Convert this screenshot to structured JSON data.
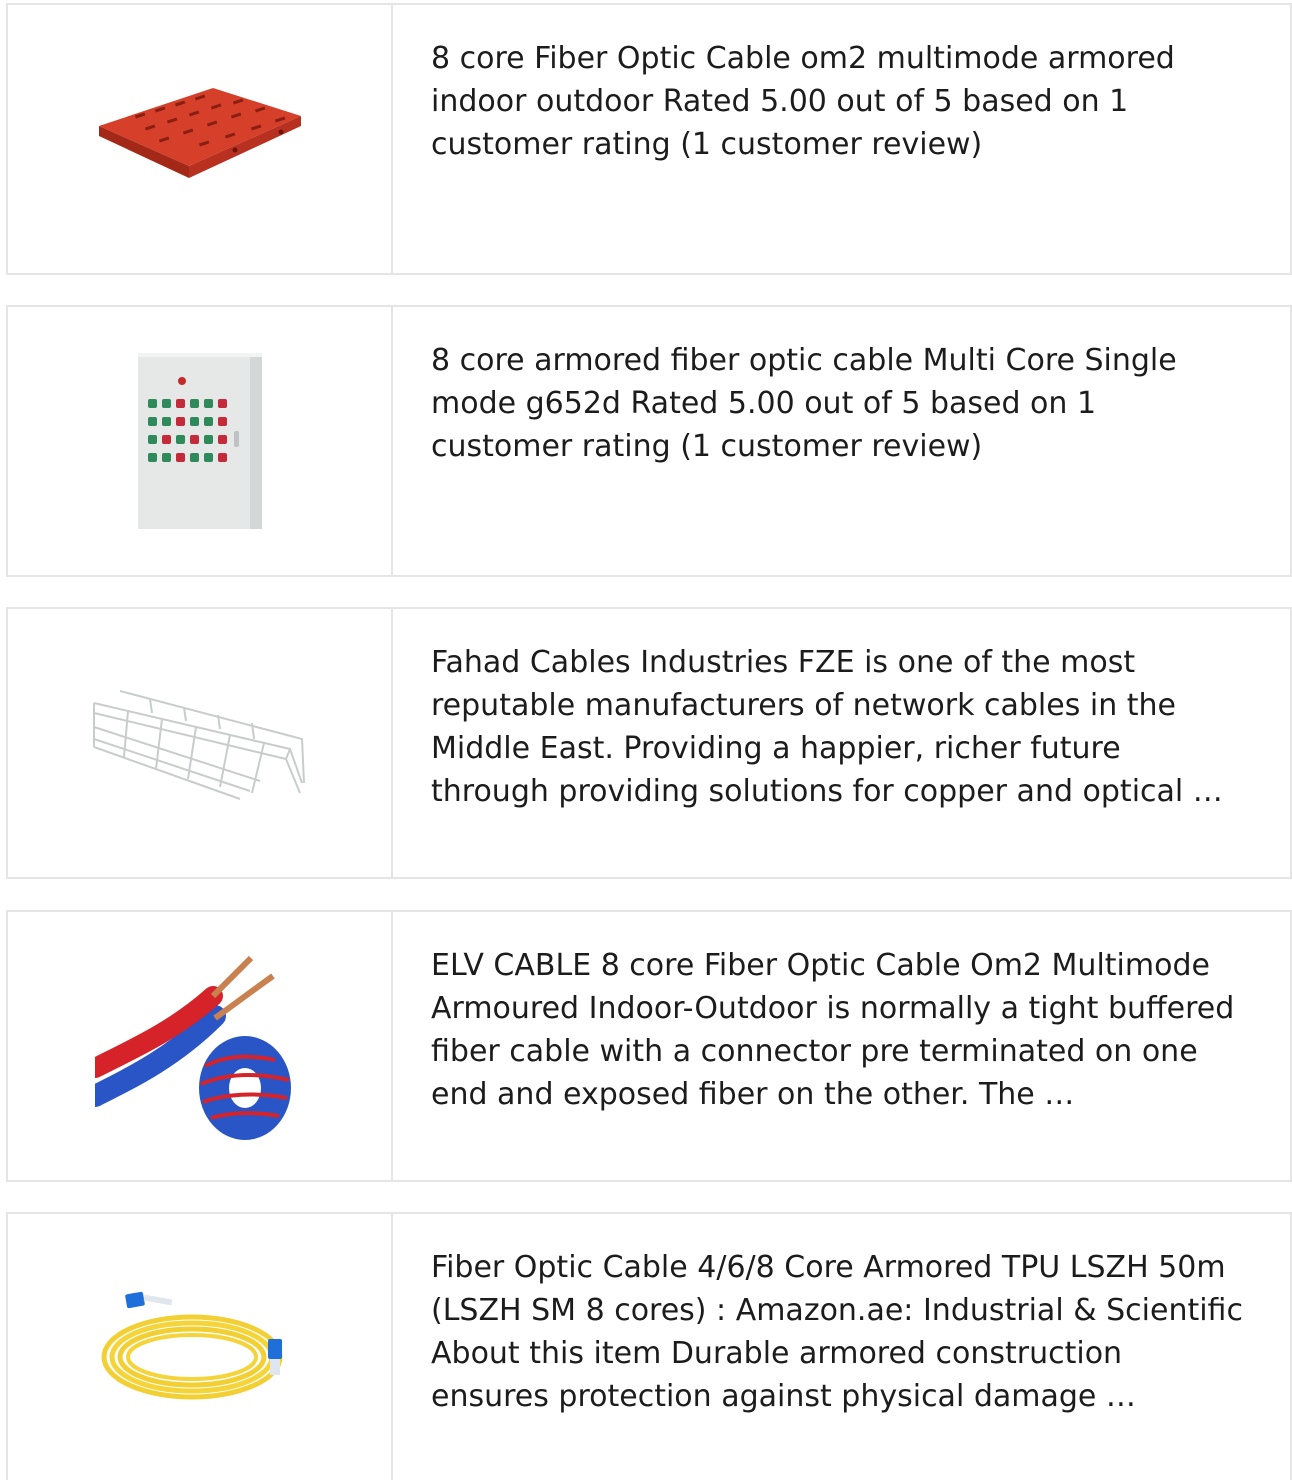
{
  "results": [
    {
      "image_icon": "red-perforated-cable-tray-image",
      "description": "8 core Fiber Optic Cable om2 multimode armored indoor outdoor Rated 5.00 out of 5 based on 1 customer rating (1 customer review)"
    },
    {
      "image_icon": "electrical-control-cabinet-image",
      "description": "8 core armored fiber optic cable Multi Core Single mode g652d Rated 5.00 out of 5 based on 1 customer rating (1 customer review)"
    },
    {
      "image_icon": "wire-mesh-cable-tray-image",
      "description": "Fahad Cables Industries FZE is one of the most reputable manufacturers of network cables in the Middle East. Providing a happier, richer future through providing solutions for copper and optical …"
    },
    {
      "image_icon": "red-blue-electric-wire-image",
      "description": "ELV CABLE 8 core Fiber Optic Cable Om2 Multimode Armoured Indoor-Outdoor is normally a tight buffered fiber cable with a connector pre terminated on one end and exposed fiber on the other. The …"
    },
    {
      "image_icon": "yellow-fiber-patch-cord-image",
      "description": "Fiber Optic Cable 4/6/8 Core Armored TPU LSZH 50m (LSZH SM 8 cores) : Amazon.ae: Industrial & Scientific About this item Durable armored construction ensures protection against physical damage …"
    }
  ],
  "colors": {
    "border": "#e5e5e5",
    "text": "#1c1c1c",
    "tray_red": "#d23a22",
    "cabinet_grey": "#e9ebeb",
    "wire_blue": "#2b56c8",
    "wire_red": "#d5242a",
    "patch_yellow": "#f5d43a",
    "connector_blue": "#1e6fd9"
  }
}
